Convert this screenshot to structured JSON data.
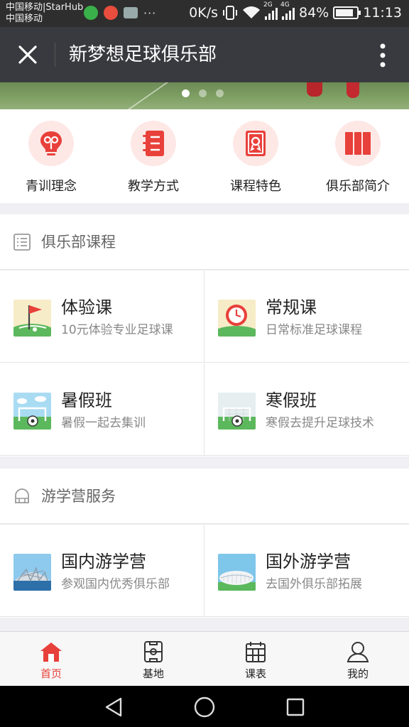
{
  "status_bar": {
    "carrier_line1": "中国移动|StarHub",
    "carrier_line2": "中国移动",
    "more": "···",
    "speed": "0K/s",
    "network_2g": "2G",
    "network_4g": "4G",
    "battery": "84%",
    "battery_level": 0.84,
    "time": "11:13"
  },
  "title_bar": {
    "title": "新梦想足球俱乐部"
  },
  "banner": {
    "slides": 3,
    "active_slide": 0
  },
  "quick_nav": [
    {
      "label": "青训理念",
      "icon": "lightbulb-icon"
    },
    {
      "label": "教学方式",
      "icon": "notebook-icon"
    },
    {
      "label": "课程特色",
      "icon": "certificate-icon"
    },
    {
      "label": "俱乐部简介",
      "icon": "book-icon"
    }
  ],
  "courses": {
    "title": "俱乐部课程",
    "icon": "list-icon",
    "items": [
      {
        "title": "体验课",
        "subtitle": "10元体验专业足球课",
        "icon": "flag-field-icon"
      },
      {
        "title": "常规课",
        "subtitle": "日常标准足球课程",
        "icon": "clock-field-icon"
      },
      {
        "title": "暑假班",
        "subtitle": "暑假一起去集训",
        "icon": "goal-summer-icon"
      },
      {
        "title": "寒假班",
        "subtitle": "寒假去提升足球技术",
        "icon": "goal-winter-icon"
      }
    ]
  },
  "camps": {
    "title": "游学营服务",
    "icon": "bag-icon",
    "items": [
      {
        "title": "国内游学营",
        "subtitle": "参观国内优秀俱乐部",
        "icon": "birds-nest-stadium-icon"
      },
      {
        "title": "国外游学营",
        "subtitle": "去国外俱乐部拓展",
        "icon": "allianz-stadium-icon"
      }
    ]
  },
  "tab_bar": [
    {
      "label": "首页",
      "icon": "home-icon",
      "active": true
    },
    {
      "label": "基地",
      "icon": "field-icon",
      "active": false
    },
    {
      "label": "课表",
      "icon": "calendar-icon",
      "active": false
    },
    {
      "label": "我的",
      "icon": "user-icon",
      "active": false
    }
  ],
  "colors": {
    "accent": "#e8403a",
    "icon_bg": "#fde8e6",
    "title_bar": "#393a3f"
  }
}
